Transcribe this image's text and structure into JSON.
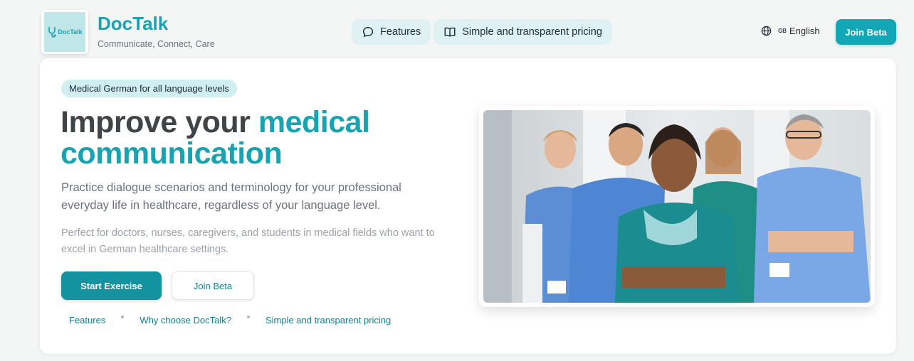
{
  "header": {
    "logo_text": "DocTalk",
    "brand_name": "DocTalk",
    "tagline": "Communicate, Connect, Care",
    "nav": [
      {
        "label": "Features",
        "icon": "chat-bubble-icon"
      },
      {
        "label": "Simple and transparent pricing",
        "icon": "open-book-icon"
      }
    ],
    "language": {
      "icon": "globe-icon",
      "flag": "GB",
      "label": "English"
    },
    "join_label": "Join Beta"
  },
  "hero": {
    "badge": "Medical German for all language levels",
    "headline_plain": "Improve your ",
    "headline_accent_1": "medical",
    "headline_accent_2": "communication",
    "lead": "Practice dialogue scenarios and terminology for your professional everyday life in healthcare, regardless of your language level.",
    "sub": "Perfect for doctors, nurses, caregivers, and students in medical fields who want to excel in German healthcare settings.",
    "primary_button": "Start Exercise",
    "secondary_button": "Join Beta",
    "links": [
      "Features",
      "Why choose DocTalk?",
      "Simple and transparent pricing"
    ]
  },
  "colors": {
    "brand": "#15a3b6",
    "primary_button": "#13929f",
    "badge_bg": "#cfeff1",
    "nav_pill_bg": "#dff1f2"
  }
}
